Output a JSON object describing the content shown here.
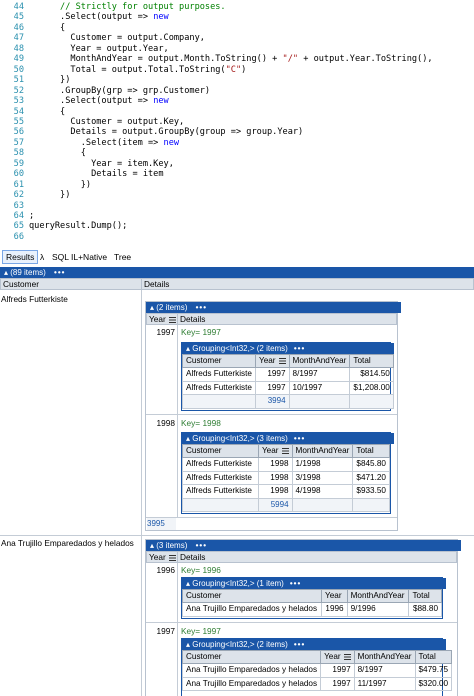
{
  "code": {
    "lines": [
      {
        "n": "44",
        "parts": [
          {
            "t": "      "
          },
          {
            "t": "// Strictly for output purposes.",
            "c": "cm"
          }
        ]
      },
      {
        "n": "45",
        "parts": [
          {
            "t": "      .Select(output => "
          },
          {
            "t": "new",
            "c": "kw"
          }
        ]
      },
      {
        "n": "46",
        "parts": [
          {
            "t": "      {"
          }
        ]
      },
      {
        "n": "47",
        "parts": [
          {
            "t": "        Customer = output.Company,"
          }
        ]
      },
      {
        "n": "48",
        "parts": [
          {
            "t": "        Year = output.Year,"
          }
        ]
      },
      {
        "n": "49",
        "parts": [
          {
            "t": "        MonthAndYear = output.Month.ToString() + "
          },
          {
            "t": "\"/\"",
            "c": "str"
          },
          {
            "t": " + output.Year.ToString(),"
          }
        ]
      },
      {
        "n": "50",
        "parts": [
          {
            "t": "        Total = output.Total.ToString("
          },
          {
            "t": "\"C\"",
            "c": "str"
          },
          {
            "t": ")"
          }
        ]
      },
      {
        "n": "51",
        "parts": [
          {
            "t": "      })"
          }
        ]
      },
      {
        "n": "52",
        "parts": [
          {
            "t": "      .GroupBy(grp => grp.Customer)"
          }
        ]
      },
      {
        "n": "53",
        "parts": [
          {
            "t": "      .Select(output => "
          },
          {
            "t": "new",
            "c": "kw"
          }
        ]
      },
      {
        "n": "54",
        "parts": [
          {
            "t": "      {"
          }
        ]
      },
      {
        "n": "55",
        "parts": [
          {
            "t": "        Customer = output.Key,"
          }
        ]
      },
      {
        "n": "56",
        "parts": [
          {
            "t": "        Details = output.GroupBy(group => group.Year)"
          }
        ]
      },
      {
        "n": "57",
        "parts": [
          {
            "t": "          .Select(item => "
          },
          {
            "t": "new",
            "c": "kw"
          }
        ]
      },
      {
        "n": "58",
        "parts": [
          {
            "t": "          {"
          }
        ]
      },
      {
        "n": "59",
        "parts": [
          {
            "t": "            Year = item.Key,"
          }
        ]
      },
      {
        "n": "60",
        "parts": [
          {
            "t": "            Details = item"
          }
        ]
      },
      {
        "n": "61",
        "parts": [
          {
            "t": "          })"
          }
        ]
      },
      {
        "n": "62",
        "parts": [
          {
            "t": "      })"
          }
        ]
      },
      {
        "n": "63",
        "parts": [
          {
            "t": ""
          }
        ]
      },
      {
        "n": "64",
        "parts": [
          {
            "t": ";"
          }
        ]
      },
      {
        "n": "65",
        "parts": [
          {
            "t": "queryResult.Dump();"
          }
        ]
      },
      {
        "n": "66",
        "parts": [
          {
            "t": ""
          }
        ]
      }
    ]
  },
  "tabs": [
    "Results",
    "λ",
    "SQL",
    "IL+Native",
    "Tree"
  ],
  "results": {
    "header": "▴ (89 items)",
    "dots": "•••",
    "col_customer": "Customer",
    "col_details": "Details",
    "customers": [
      {
        "name": "Alfreds Futterkiste",
        "header": "▴ (2 items)",
        "col_year": "Year",
        "col_details": "Details",
        "groups": [
          {
            "year": "1997",
            "key_label": "Key= 1997",
            "header": "▴ Grouping<Int32,> (2 items)",
            "cols": [
              "Customer",
              "Year",
              "MonthAndYear",
              "Total"
            ],
            "rows": [
              [
                "Alfreds Futterkiste",
                "1997",
                "8/1997",
                "$814.50"
              ],
              [
                "Alfreds Futterkiste",
                "1997",
                "10/1997",
                "$1,208.00"
              ]
            ],
            "sum": "3994"
          },
          {
            "year": "1998",
            "key_label": "Key= 1998",
            "header": "▴ Grouping<Int32,> (3 items)",
            "cols": [
              "Customer",
              "Year",
              "MonthAndYear",
              "Total"
            ],
            "rows": [
              [
                "Alfreds Futterkiste",
                "1998",
                "1/1998",
                "$845.80"
              ],
              [
                "Alfreds Futterkiste",
                "1998",
                "3/1998",
                "$471.20"
              ],
              [
                "Alfreds Futterkiste",
                "1998",
                "4/1998",
                "$933.50"
              ]
            ],
            "sum": "5994"
          }
        ],
        "sum": "3995"
      },
      {
        "name": "Ana Trujillo Emparedados y helados",
        "header": "▴ (3 items)",
        "col_year": "Year",
        "col_details": "Details",
        "groups": [
          {
            "year": "1996",
            "key_label": "Key= 1996",
            "header": "▴ Grouping<Int32,> (1 item)",
            "cols": [
              "Customer",
              "Year",
              "MonthAndYear",
              "Total"
            ],
            "rows": [
              [
                "Ana Trujillo Emparedados y helados",
                "1996",
                "9/1996",
                "$88.80"
              ]
            ]
          },
          {
            "year": "1997",
            "key_label": "Key= 1997",
            "header": "▴ Grouping<Int32,> (2 items)",
            "cols": [
              "Customer",
              "Year",
              "MonthAndYear",
              "Total"
            ],
            "rows": [
              [
                "Ana Trujillo Emparedados y helados",
                "1997",
                "8/1997",
                "$479.75"
              ],
              [
                "Ana Trujillo Emparedados y helados",
                "1997",
                "11/1997",
                "$320.00"
              ]
            ]
          }
        ]
      }
    ]
  }
}
